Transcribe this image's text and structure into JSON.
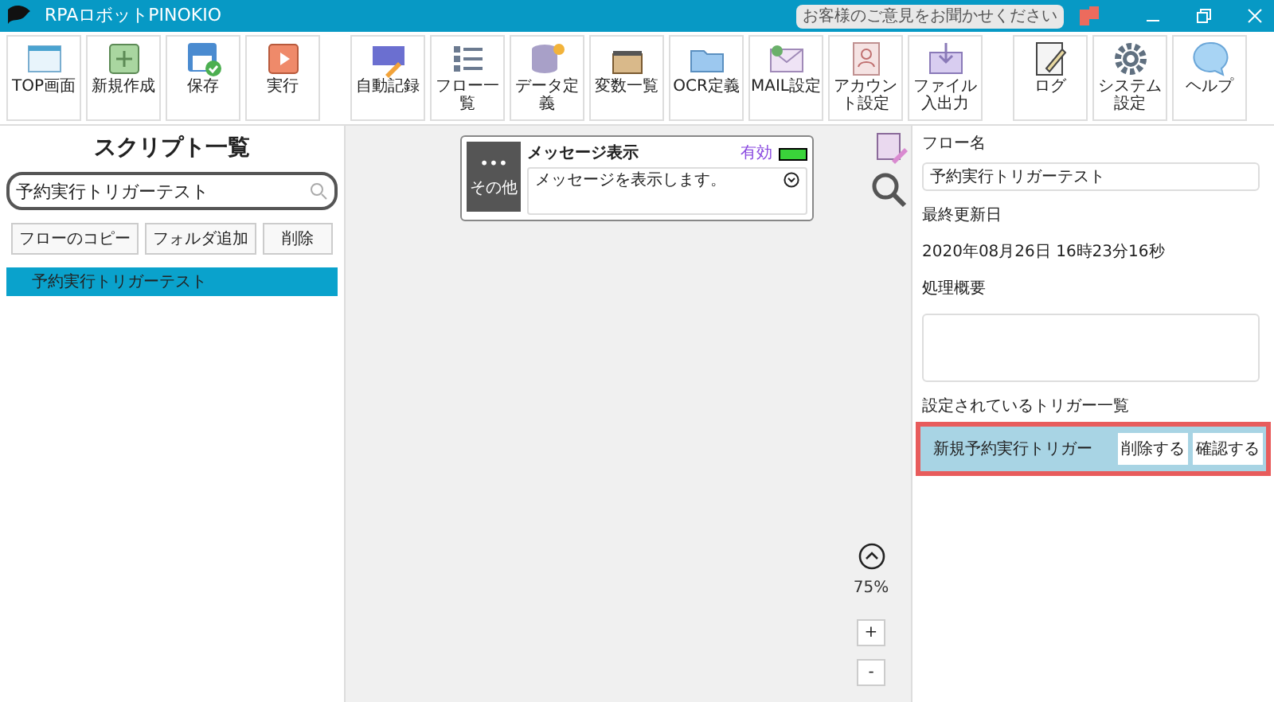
{
  "window": {
    "title": "RPAロボットPINOKIO",
    "feedback": "お客様のご意見をお聞かせください"
  },
  "toolbar": [
    {
      "label": "TOP画面",
      "kind": "top"
    },
    {
      "label": "新規作成",
      "kind": "new"
    },
    {
      "label": "保存",
      "kind": "save"
    },
    {
      "label": "実行",
      "kind": "run"
    },
    {
      "label": "自動記録",
      "kind": "record",
      "group_start": true
    },
    {
      "label": "フロー一覧",
      "kind": "list"
    },
    {
      "label": "データ定義",
      "kind": "data"
    },
    {
      "label": "変数一覧",
      "kind": "box"
    },
    {
      "label": "OCR定義",
      "kind": "ocr"
    },
    {
      "label": "MAIL設定",
      "kind": "mail"
    },
    {
      "label": "アカウント設定",
      "kind": "account"
    },
    {
      "label": "ファイル入出力",
      "kind": "file"
    },
    {
      "label": "ログ",
      "kind": "log",
      "group_start": true
    },
    {
      "label": "システム設定",
      "kind": "gear"
    },
    {
      "label": "ヘルプ",
      "kind": "help"
    }
  ],
  "sidebar": {
    "title": "スクリプト一覧",
    "search": {
      "value": "予約実行トリガーテスト"
    },
    "buttons": [
      "フローのコピー",
      "フォルダ追加",
      "削除"
    ],
    "items": [
      {
        "label": "予約実行トリガーテスト",
        "selected": true
      }
    ]
  },
  "canvas": {
    "node": {
      "category": "その他",
      "badge": "•••",
      "title": "メッセージ表示",
      "status": "有効",
      "enabled": true,
      "description": "メッセージを表示します。"
    },
    "zoom": "75%",
    "zoom_in": "+",
    "zoom_out": "-"
  },
  "properties": {
    "flow_name_label": "フロー名",
    "flow_name": "予約実行トリガーテスト",
    "updated_label": "最終更新日",
    "updated": "2020年08月26日 16時23分16秒",
    "summary_label": "処理概要",
    "triggers_label": "設定されているトリガー一覧",
    "triggers": [
      {
        "name": "新規予約実行トリガー",
        "highlighted": true,
        "buttons": [
          "削除する",
          "確認する"
        ]
      }
    ]
  }
}
